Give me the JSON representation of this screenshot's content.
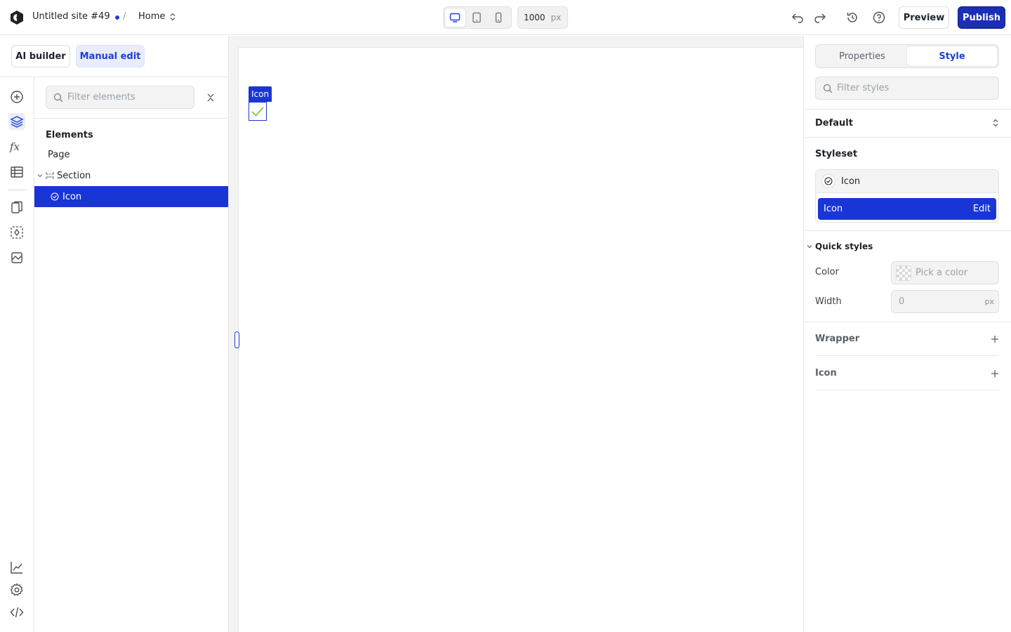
{
  "topbar": {
    "site_name": "Untitled site #49",
    "separator": "/",
    "page_name": "Home",
    "canvas_width": "1000",
    "canvas_unit": "px",
    "preview_label": "Preview",
    "publish_label": "Publish"
  },
  "modes": {
    "ai_builder": "AI builder",
    "manual_edit": "Manual edit"
  },
  "elements": {
    "filter_placeholder": "Filter elements",
    "heading": "Elements",
    "tree": {
      "page": "Page",
      "section": "Section",
      "icon": "Icon"
    }
  },
  "canvas": {
    "selection_label": "Icon"
  },
  "right_panel": {
    "tabs": {
      "properties": "Properties",
      "style": "Style"
    },
    "filter_placeholder": "Filter styles",
    "state": "Default",
    "styleset": {
      "title": "Styleset",
      "head_label": "Icon",
      "item_label": "Icon",
      "edit_label": "Edit"
    },
    "quick_styles": {
      "title": "Quick styles",
      "color_label": "Color",
      "color_placeholder": "Pick a color",
      "width_label": "Width",
      "width_placeholder": "0",
      "width_unit": "px"
    },
    "sections": {
      "wrapper": "Wrapper",
      "icon": "Icon"
    }
  },
  "colors": {
    "accent": "#1a35d6",
    "publish": "#1a2fb5",
    "check_icon": "#8bc34a"
  }
}
